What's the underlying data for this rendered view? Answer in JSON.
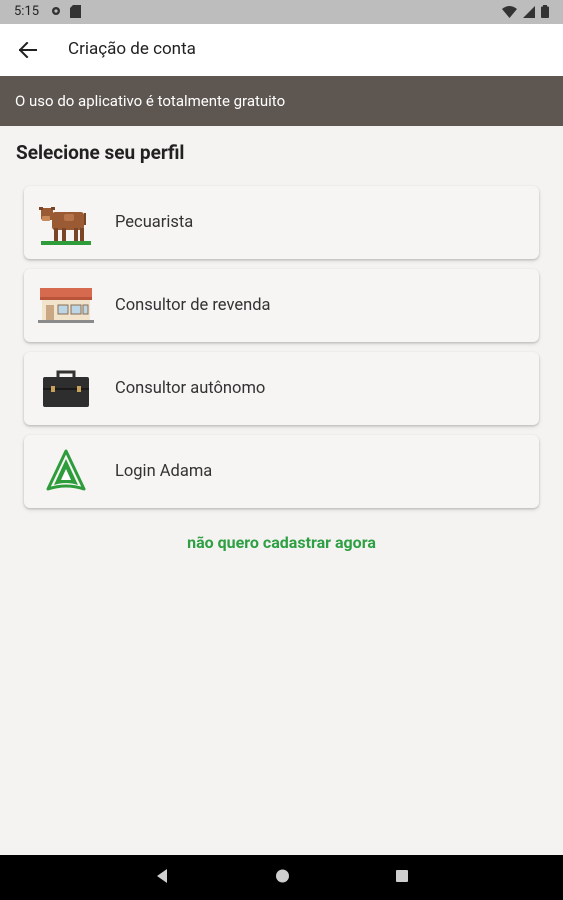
{
  "status": {
    "time": "5:15"
  },
  "app_bar": {
    "title": "Criação de conta"
  },
  "banner": {
    "text": "O uso do aplicativo é totalmente gratuito"
  },
  "section": {
    "title": "Selecione seu perfil"
  },
  "profiles": [
    {
      "label": "Pecuarista",
      "icon": "cow-icon"
    },
    {
      "label": "Consultor de revenda",
      "icon": "store-icon"
    },
    {
      "label": "Consultor autônomo",
      "icon": "briefcase-icon"
    },
    {
      "label": "Login Adama",
      "icon": "adama-logo-icon"
    }
  ],
  "skip_link": "não quero cadastrar agora",
  "colors": {
    "banner_bg": "#5e5751",
    "accent_green": "#2ea043",
    "background": "#f4f3f1"
  }
}
